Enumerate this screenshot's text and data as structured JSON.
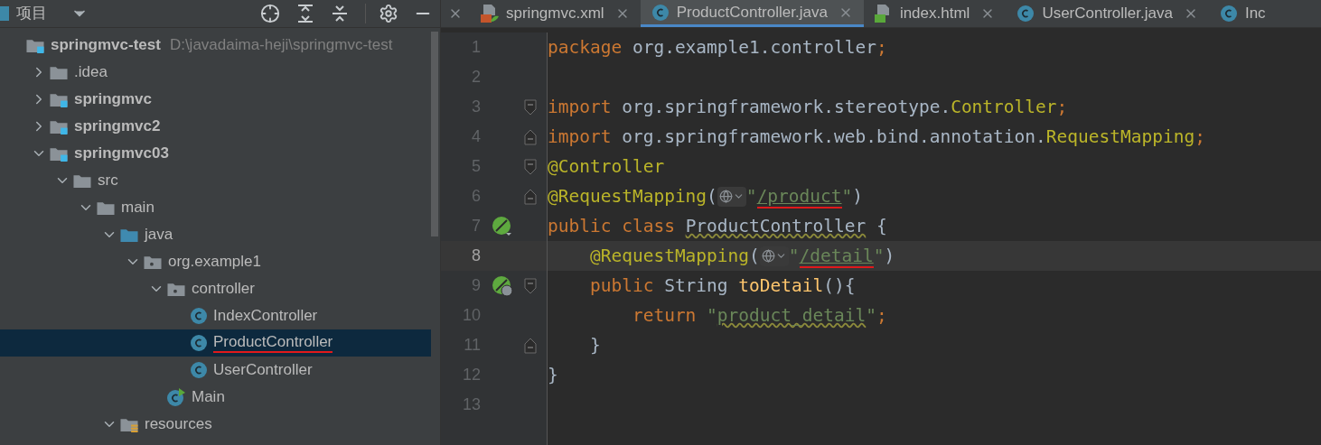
{
  "project_panel": {
    "title": "项目",
    "tree": [
      {
        "label": "springmvc-test",
        "kind": "module",
        "bold": true,
        "hint": "D:\\javadaima-heji\\springmvc-test",
        "selected": false,
        "children": [
          {
            "label": ".idea",
            "kind": "folder",
            "bold": false,
            "expanded": false,
            "selected": false
          },
          {
            "label": "springmvc",
            "kind": "module",
            "bold": true,
            "expanded": false,
            "selected": false
          },
          {
            "label": "springmvc2",
            "kind": "module",
            "bold": true,
            "expanded": false,
            "selected": false
          },
          {
            "label": "springmvc03",
            "kind": "module",
            "bold": true,
            "expanded": true,
            "selected": false,
            "children": [
              {
                "label": "src",
                "kind": "folder",
                "bold": false,
                "expanded": true,
                "selected": false,
                "children": [
                  {
                    "label": "main",
                    "kind": "folder",
                    "bold": false,
                    "expanded": true,
                    "selected": false,
                    "children": [
                      {
                        "label": "java",
                        "kind": "source",
                        "bold": false,
                        "expanded": true,
                        "selected": false,
                        "children": [
                          {
                            "label": "org.example1",
                            "kind": "package",
                            "bold": false,
                            "expanded": true,
                            "selected": false,
                            "children": [
                              {
                                "label": "controller",
                                "kind": "package",
                                "bold": false,
                                "expanded": true,
                                "selected": false,
                                "children": [
                                  {
                                    "label": "IndexController",
                                    "kind": "class",
                                    "bold": false,
                                    "selected": false,
                                    "annotated": false
                                  },
                                  {
                                    "label": "ProductController",
                                    "kind": "class",
                                    "bold": false,
                                    "selected": true,
                                    "annotated": true
                                  },
                                  {
                                    "label": "UserController",
                                    "kind": "class",
                                    "bold": false,
                                    "selected": false,
                                    "annotated": false
                                  }
                                ]
                              },
                              {
                                "label": "Main",
                                "kind": "main",
                                "bold": false,
                                "selected": false,
                                "annotated": false
                              }
                            ]
                          }
                        ]
                      },
                      {
                        "label": "resources",
                        "kind": "resources",
                        "bold": false,
                        "expanded": true,
                        "selected": false
                      }
                    ]
                  }
                ]
              }
            ]
          }
        ]
      }
    ]
  },
  "tabs": [
    {
      "label": "springmvc.xml",
      "kind": "xml",
      "selected": false
    },
    {
      "label": "ProductController.java",
      "kind": "class",
      "selected": true
    },
    {
      "label": "index.html",
      "kind": "html",
      "selected": false
    },
    {
      "label": "UserController.java",
      "kind": "class",
      "selected": false
    },
    {
      "label": "Inc",
      "kind": "class",
      "selected": false
    }
  ],
  "editor": {
    "lines": [
      {
        "number": "1",
        "current": false,
        "tokens": [
          {
            "kind": "keyword",
            "text": "package "
          },
          {
            "kind": "plain",
            "text": "org.example1.controller"
          },
          {
            "kind": "keyword",
            "text": ";"
          }
        ]
      },
      {
        "number": "2",
        "current": false
      },
      {
        "number": "3",
        "current": false,
        "fold_start": true,
        "tokens": [
          {
            "kind": "keyword",
            "text": "import "
          },
          {
            "kind": "plain",
            "text": "org.springframework.stereotype."
          },
          {
            "kind": "annotation",
            "text": "Controller"
          },
          {
            "kind": "keyword",
            "text": ";"
          }
        ]
      },
      {
        "number": "4",
        "current": false,
        "fold_end": true,
        "tokens": [
          {
            "kind": "keyword",
            "text": "import "
          },
          {
            "kind": "plain",
            "text": "org.springframework.web.bind.annotation."
          },
          {
            "kind": "annotation",
            "text": "RequestMapping"
          },
          {
            "kind": "keyword",
            "text": ";"
          }
        ]
      },
      {
        "number": "5",
        "current": false,
        "fold_start": true,
        "tokens": [
          {
            "kind": "annotation",
            "text": "@Controller"
          }
        ]
      },
      {
        "number": "6",
        "current": false,
        "fold_end": true,
        "tokens": [
          {
            "kind": "annotation",
            "text": "@RequestMapping"
          },
          {
            "kind": "plain",
            "text": "("
          },
          {
            "kind": "chip"
          },
          {
            "kind": "string",
            "text": "\""
          },
          {
            "kind": "string",
            "text": "/product",
            "link": true,
            "annotated": true
          },
          {
            "kind": "string",
            "text": "\""
          },
          {
            "kind": "plain",
            "text": ")"
          }
        ]
      },
      {
        "number": "7",
        "current": false,
        "spring_bean": true,
        "tokens": [
          {
            "kind": "keyword",
            "text": "public class "
          },
          {
            "kind": "plain",
            "text": "ProductController",
            "warning": true
          },
          {
            "kind": "plain",
            "text": " {"
          }
        ]
      },
      {
        "number": "8",
        "current": true,
        "tokens": [
          {
            "kind": "annotation",
            "text": "    @RequestMapping"
          },
          {
            "kind": "plain",
            "text": "("
          },
          {
            "kind": "chip"
          },
          {
            "kind": "string",
            "text": "\""
          },
          {
            "kind": "string",
            "text": "/detail",
            "link": true,
            "annotated": true
          },
          {
            "kind": "string",
            "text": "\""
          },
          {
            "kind": "plain",
            "text": ")"
          }
        ]
      },
      {
        "number": "9",
        "current": false,
        "web_endpoint": true,
        "fold_start": true,
        "tokens": [
          {
            "kind": "keyword",
            "text": "    public "
          },
          {
            "kind": "plain",
            "text": "String "
          },
          {
            "kind": "method",
            "text": "toDetail"
          },
          {
            "kind": "plain",
            "text": "(){"
          }
        ]
      },
      {
        "number": "10",
        "current": false,
        "tokens": [
          {
            "kind": "keyword",
            "text": "        return "
          },
          {
            "kind": "string",
            "text": "\""
          },
          {
            "kind": "string",
            "text": "product_detail",
            "warning": true
          },
          {
            "kind": "string",
            "text": "\""
          },
          {
            "kind": "keyword",
            "text": ";"
          }
        ]
      },
      {
        "number": "11",
        "current": false,
        "fold_end": true,
        "tokens": [
          {
            "kind": "plain",
            "text": "    }"
          }
        ]
      },
      {
        "number": "12",
        "current": false,
        "tokens": [
          {
            "kind": "plain",
            "text": "}"
          }
        ]
      },
      {
        "number": "13",
        "current": false
      }
    ]
  }
}
